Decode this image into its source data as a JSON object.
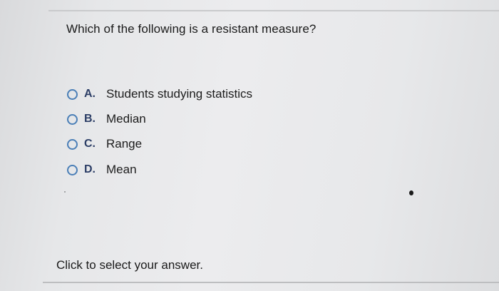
{
  "question": {
    "text": "Which of the following is a resistant measure?"
  },
  "choices": [
    {
      "letter": "A.",
      "text": "Students studying statistics"
    },
    {
      "letter": "B.",
      "text": "Median"
    },
    {
      "letter": "C.",
      "text": "Range"
    },
    {
      "letter": "D.",
      "text": "Mean"
    }
  ],
  "footer": {
    "instruction": "Click to select your answer."
  },
  "colors": {
    "radio_border": "#4b7fb7",
    "letter": "#2c3e66",
    "text": "#1c1c1c"
  }
}
